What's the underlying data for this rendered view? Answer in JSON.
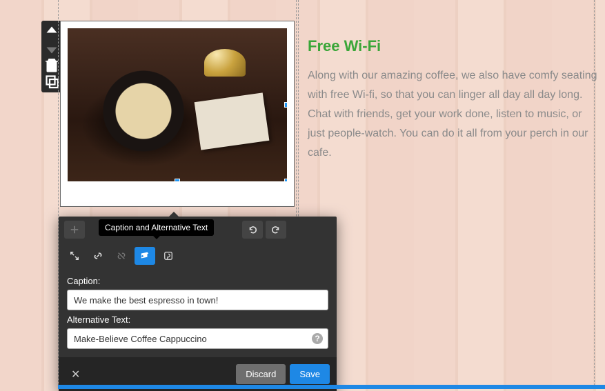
{
  "mini_toolbar": {
    "move_up": "move-up",
    "move_down": "move-down",
    "delete": "delete",
    "copy": "copy"
  },
  "content": {
    "heading": "Free Wi-Fi",
    "body": "Along with our amazing coffee, we also have comfy seating with free Wi-fi, so that you can linger all day all day long. Chat with friends, get your work done, listen to music, or just people-watch. You can do it all from your perch in our cafe."
  },
  "editor": {
    "tooltip": "Caption and Alternative Text",
    "caption_label": "Caption:",
    "caption_value": "We make the best espresso in town!",
    "alt_label": "Alternative Text:",
    "alt_value": "Make-Believe Coffee Cappuccino",
    "discard_label": "Discard",
    "save_label": "Save"
  },
  "icons": {
    "plus": "+",
    "expand": "expand",
    "link": "link",
    "unlink": "unlink",
    "tag": "tag",
    "pinterest": "pinterest",
    "undo": "undo",
    "redo": "redo"
  },
  "colors": {
    "accent_green": "#3aa638",
    "accent_blue": "#1e88e5",
    "panel_bg": "#333",
    "toolbar_btn": "#444"
  }
}
